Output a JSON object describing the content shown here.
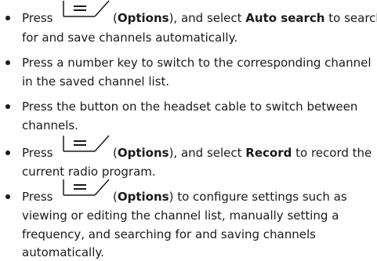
{
  "icons": {
    "options_softkey": "options-softkey-icon",
    "bullet": "bullet-dot"
  },
  "items": [
    {
      "press": "Press",
      "options_label": "Options",
      "mid": "), and select ",
      "action_label": "Auto search",
      "tail": " to search",
      "line2": "for and save channels automatically."
    },
    {
      "line1": "Press a number key to switch to the corresponding channel",
      "line2": "in the saved channel list."
    },
    {
      "line1": "Press the button on the headset cable to switch between",
      "line2": "channels."
    },
    {
      "press": "Press",
      "options_label": "Options",
      "mid": "), and select ",
      "action_label": "Record",
      "tail": " to record the",
      "line2": "current radio program."
    },
    {
      "press": "Press",
      "options_label": "Options",
      "tail": ") to configure settings such as",
      "line2": "viewing or editing the channel list, manually setting a",
      "line3": "frequency, and searching for and saving channels",
      "line4": "automatically."
    }
  ]
}
